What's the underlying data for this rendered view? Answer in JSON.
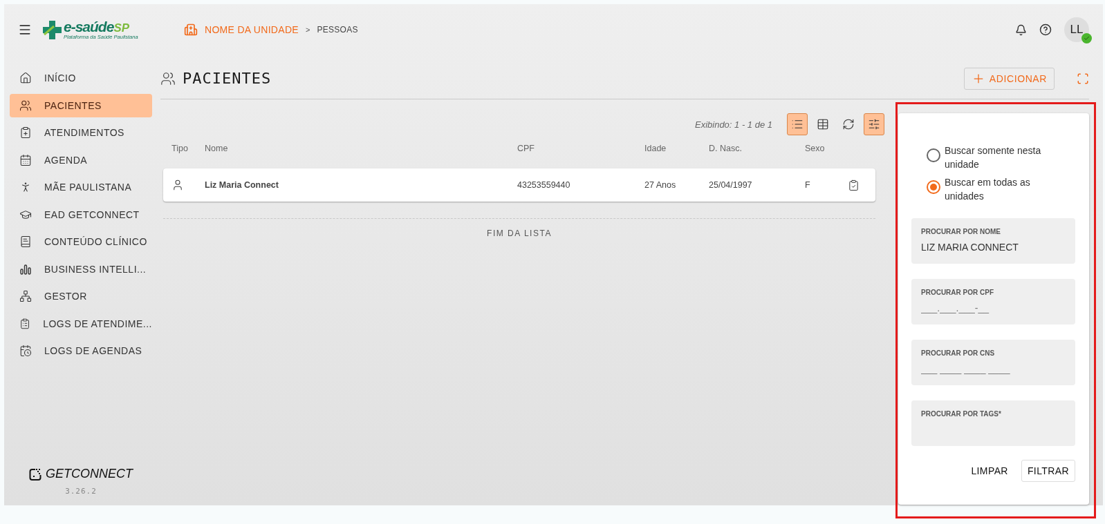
{
  "header": {
    "logo": {
      "brand": "e-saúde",
      "region": "SP",
      "tagline": "Plataforma da Saúde Paulistana"
    },
    "breadcrumb": {
      "unit": "NOME DA UNIDADE",
      "separator": ">",
      "current": "PESSOAS"
    },
    "avatar": {
      "initials": "LL",
      "online": true
    }
  },
  "sidebar": {
    "items": [
      {
        "label": "INÍCIO",
        "selected": false
      },
      {
        "label": "PACIENTES",
        "selected": true
      },
      {
        "label": "ATENDIMENTOS",
        "selected": false
      },
      {
        "label": "AGENDA",
        "selected": false
      },
      {
        "label": "MÃE PAULISTANA",
        "selected": false
      },
      {
        "label": "EAD GETCONNECT",
        "selected": false
      },
      {
        "label": "CONTEÚDO CLÍNICO",
        "selected": false
      },
      {
        "label": "BUSINESS INTELLI...",
        "selected": false
      },
      {
        "label": "GESTOR",
        "selected": false
      },
      {
        "label": "LOGS DE ATENDIME...",
        "selected": false
      },
      {
        "label": "LOGS DE AGENDAS",
        "selected": false
      }
    ],
    "footer_logo": "**GET**CONNECT",
    "version": "3.26.2"
  },
  "page": {
    "title": "PACIENTES",
    "add_button": "ADICIONAR"
  },
  "list": {
    "count": "Exibindo: 1 - 1 de 1",
    "view_buttons": [
      {
        "kind": "list",
        "selected": true
      },
      {
        "kind": "table",
        "selected": false
      },
      {
        "kind": "refresh",
        "selected": false
      },
      {
        "kind": "filter",
        "selected": true
      }
    ],
    "columns": [
      "Tipo",
      "Nome",
      "CPF",
      "Idade",
      "D. Nasc.",
      "Sexo"
    ],
    "rows": [
      {
        "nome": "Liz Maria Connect",
        "cpf": "43253559440",
        "idade": "27 Anos",
        "nascimento": "25/04/1997",
        "sexo": "F"
      }
    ],
    "end_text": "FIM DA LISTA"
  },
  "filter_panel": {
    "scope": [
      {
        "label": "Buscar somente nesta unidade",
        "selected": false
      },
      {
        "label": "Buscar em todas as unidades",
        "selected": true
      }
    ],
    "fields": [
      {
        "label": "PROCURAR POR NOME",
        "value": "LIZ MARIA CONNECT"
      },
      {
        "label": "PROCURAR POR CPF",
        "placeholder": "___.___.___-__"
      },
      {
        "label": "PROCURAR POR CNS",
        "placeholder": "___ ____ ____ ____"
      },
      {
        "label": "PROCURAR POR TAGS*"
      }
    ],
    "buttons": [
      "LIMPAR",
      "FILTRAR"
    ]
  }
}
